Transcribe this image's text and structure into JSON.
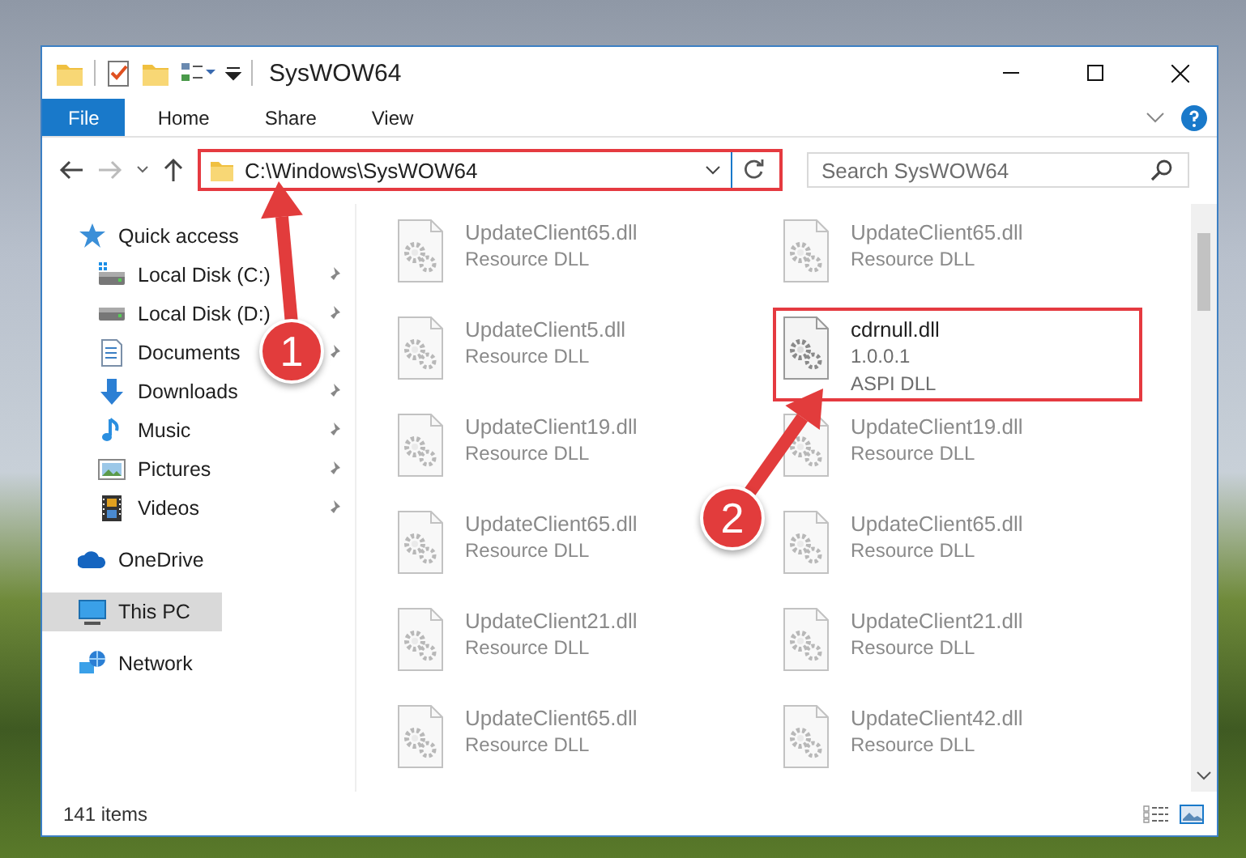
{
  "window": {
    "title": "SysWOW64"
  },
  "ribbon": {
    "tabs": [
      {
        "label": "File",
        "kind": "file",
        "selected": false
      },
      {
        "label": "Home",
        "kind": "tab",
        "selected": false
      },
      {
        "label": "Share",
        "kind": "tab",
        "selected": false
      },
      {
        "label": "View",
        "kind": "tab",
        "selected": false
      }
    ]
  },
  "address_bar": {
    "path": "C:\\Windows\\SysWOW64",
    "highlighted": true
  },
  "search": {
    "placeholder": "Search SysWOW64"
  },
  "sidebar": {
    "items": [
      {
        "label": "Quick access",
        "kind": "star",
        "selected": false,
        "children": [
          {
            "label": "Local Disk (C:)",
            "kind": "system-drive",
            "pinned": true,
            "selected": false
          },
          {
            "label": "Local Disk (D:)",
            "kind": "drive",
            "pinned": true,
            "selected": false
          },
          {
            "label": "Documents",
            "kind": "documents",
            "pinned": true,
            "selected": false
          },
          {
            "label": "Downloads",
            "kind": "downloads",
            "pinned": true,
            "selected": false
          },
          {
            "label": "Music",
            "kind": "music",
            "pinned": true,
            "selected": false
          },
          {
            "label": "Pictures",
            "kind": "pictures",
            "pinned": true,
            "selected": false
          },
          {
            "label": "Videos",
            "kind": "videos",
            "pinned": true,
            "selected": false
          }
        ]
      },
      {
        "label": "OneDrive",
        "kind": "cloud",
        "selected": false
      },
      {
        "label": "This PC",
        "kind": "computer",
        "selected": true
      },
      {
        "label": "Network",
        "kind": "network",
        "selected": false
      }
    ]
  },
  "files": [
    {
      "name": "UpdateClient65.dll",
      "lines": [
        "Resource DLL"
      ],
      "blurred": true,
      "highlighted": false
    },
    {
      "name": "UpdateClient65.dll",
      "lines": [
        "Resource DLL"
      ],
      "blurred": true,
      "highlighted": false
    },
    {
      "name": "UpdateClient5.dll",
      "lines": [
        "Resource DLL"
      ],
      "blurred": true,
      "highlighted": false
    },
    {
      "name": "cdrnull.dll",
      "lines": [
        "1.0.0.1",
        "ASPI DLL"
      ],
      "blurred": false,
      "highlighted": true
    },
    {
      "name": "UpdateClient19.dll",
      "lines": [
        "Resource DLL"
      ],
      "blurred": true,
      "highlighted": false
    },
    {
      "name": "UpdateClient19.dll",
      "lines": [
        "Resource DLL"
      ],
      "blurred": true,
      "highlighted": false
    },
    {
      "name": "UpdateClient65.dll",
      "lines": [
        "Resource DLL"
      ],
      "blurred": true,
      "highlighted": false
    },
    {
      "name": "UpdateClient65.dll",
      "lines": [
        "Resource DLL"
      ],
      "blurred": true,
      "highlighted": false
    },
    {
      "name": "UpdateClient21.dll",
      "lines": [
        "Resource DLL"
      ],
      "blurred": true,
      "highlighted": false
    },
    {
      "name": "UpdateClient21.dll",
      "lines": [
        "Resource DLL"
      ],
      "blurred": true,
      "highlighted": false
    },
    {
      "name": "UpdateClient65.dll",
      "lines": [
        "Resource DLL"
      ],
      "blurred": true,
      "highlighted": false
    },
    {
      "name": "UpdateClient42.dll",
      "lines": [
        "Resource DLL"
      ],
      "blurred": true,
      "highlighted": false
    }
  ],
  "status_bar": {
    "item_count": "141 items"
  },
  "annotations": [
    {
      "label": "1"
    },
    {
      "label": "2"
    }
  ]
}
